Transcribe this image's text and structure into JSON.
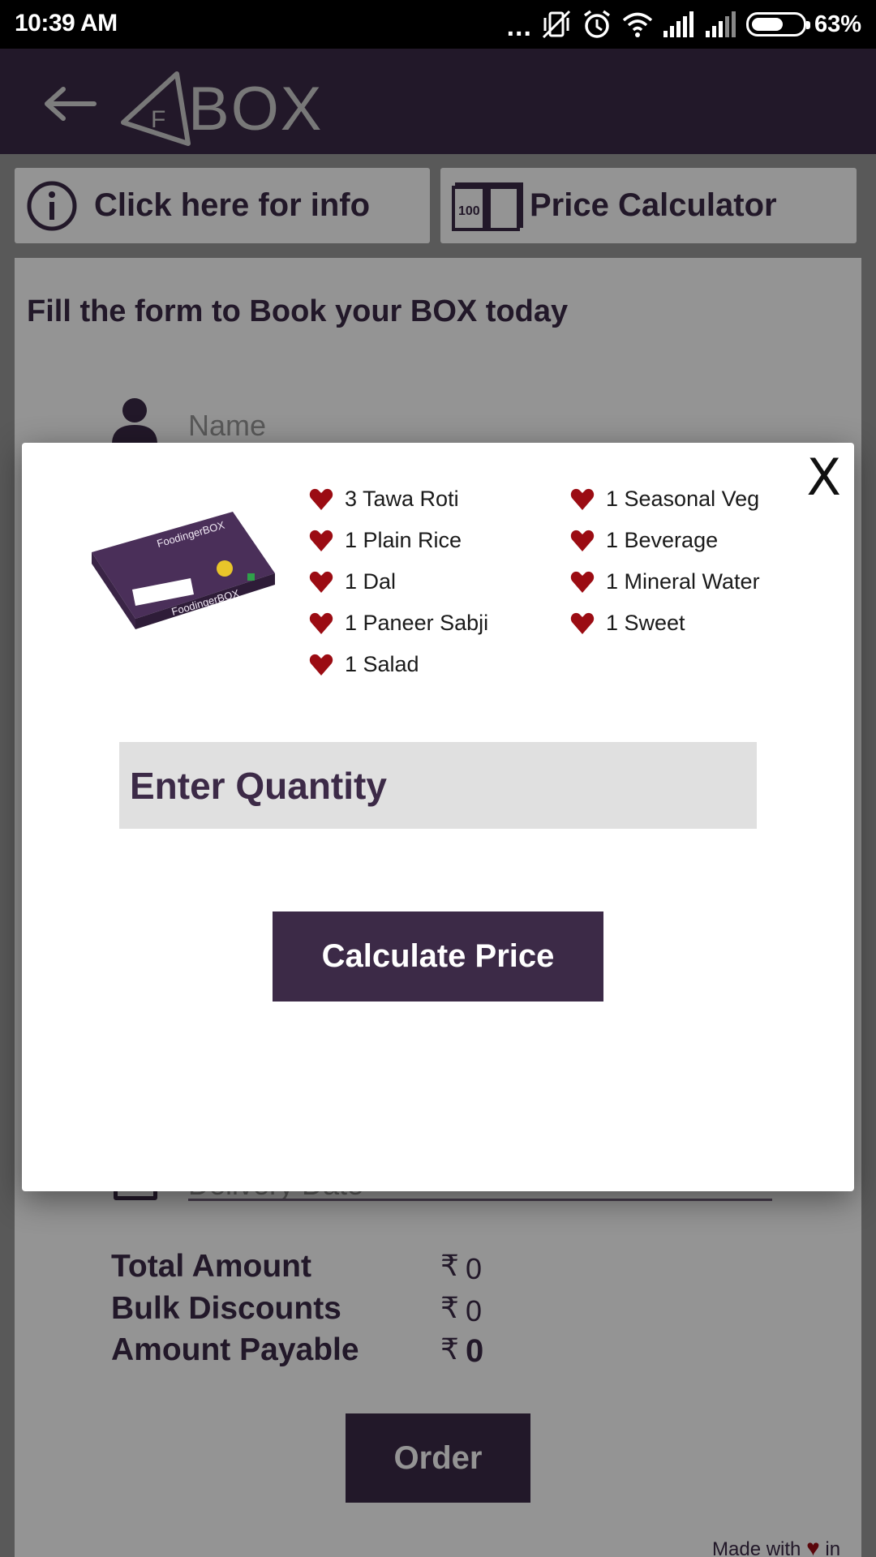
{
  "status_bar": {
    "time": "10:39 AM",
    "more": "...",
    "battery_level": 0.63,
    "battery_percent": "63%",
    "icons": [
      "vibrate-off-icon",
      "alarm-icon",
      "wifi-icon",
      "signal-icon",
      "signal-icon",
      "battery-icon"
    ]
  },
  "app_bar": {
    "logo_letter": "F",
    "logo_text": "BOX",
    "back_icon": "arrow-left-icon"
  },
  "actions": {
    "info_label": "Click here for info",
    "price_label": "Price Calculator",
    "price_icon_note": "100"
  },
  "form": {
    "title": "Fill the form to Book your BOX today",
    "name_placeholder": "Name",
    "delivery_placeholder": "Delivery Date"
  },
  "summary": {
    "total_label": "Total Amount",
    "discount_label": "Bulk Discounts",
    "payable_label": "Amount Payable",
    "currency": "₹",
    "total_value": "0",
    "discount_value": "0",
    "payable_value": "0"
  },
  "order_label": "Order",
  "footer": {
    "made_with": "Made with",
    "in": "in"
  },
  "modal": {
    "close_label": "X",
    "box_img": {
      "brand": "FoodingerBOX"
    },
    "items_left": [
      "3 Tawa Roti",
      "1 Plain Rice",
      "1 Dal",
      "1 Paneer Sabji",
      "1 Salad"
    ],
    "items_right": [
      "1 Seasonal Veg",
      "1 Beverage",
      "1 Mineral Water",
      "1 Sweet"
    ],
    "quantity_placeholder": "Enter Quantity",
    "calculate_label": "Calculate Price"
  },
  "colors": {
    "brand_purple": "#3c2a47",
    "heart_red": "#9b0c13",
    "input_gray": "#e0e0e0"
  }
}
